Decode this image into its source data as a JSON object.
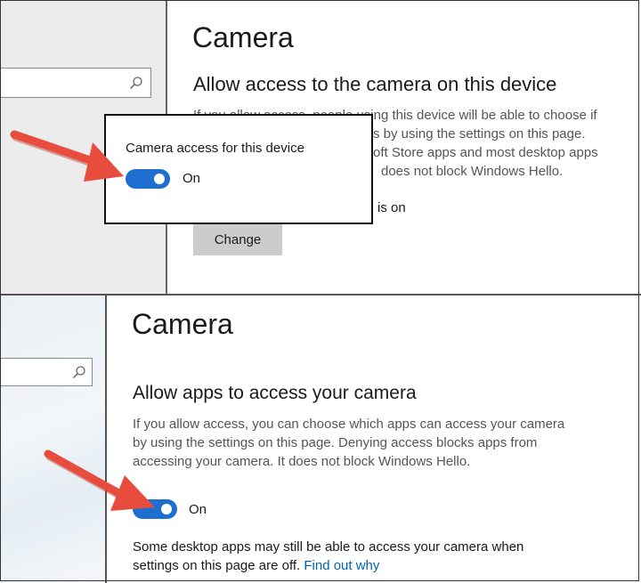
{
  "top": {
    "page_title": "Camera",
    "section_title": "Allow access to the camera on this device",
    "description_lines": [
      "If you allow access, people using this device will be able to choose if",
      "s by using the settings on this page.",
      "oft Store apps and most desktop apps",
      "does not block Windows Hello."
    ],
    "status_fragment": "is on",
    "change_button": "Change",
    "popup": {
      "label": "Camera access for this device",
      "toggle_state": "On",
      "toggle_on": true
    }
  },
  "bottom": {
    "page_title": "Camera",
    "section_title": "Allow apps to access your camera",
    "description_lines": [
      "If you allow access, you can choose which apps can access your camera",
      "by using the settings on this page. Denying access blocks apps from",
      "accessing your camera. It does not block Windows Hello."
    ],
    "toggle_state": "On",
    "toggle_on": true,
    "note_line1": "Some desktop apps may still be able to access your camera when",
    "note_line2": "settings on this page are off.",
    "note_link": "Find out why"
  },
  "colors": {
    "toggle_on": "#1e6fd0",
    "arrow": "#e84c3d",
    "link": "#0063b1"
  },
  "icons": [
    "search-icon",
    "arrow-annotation"
  ]
}
